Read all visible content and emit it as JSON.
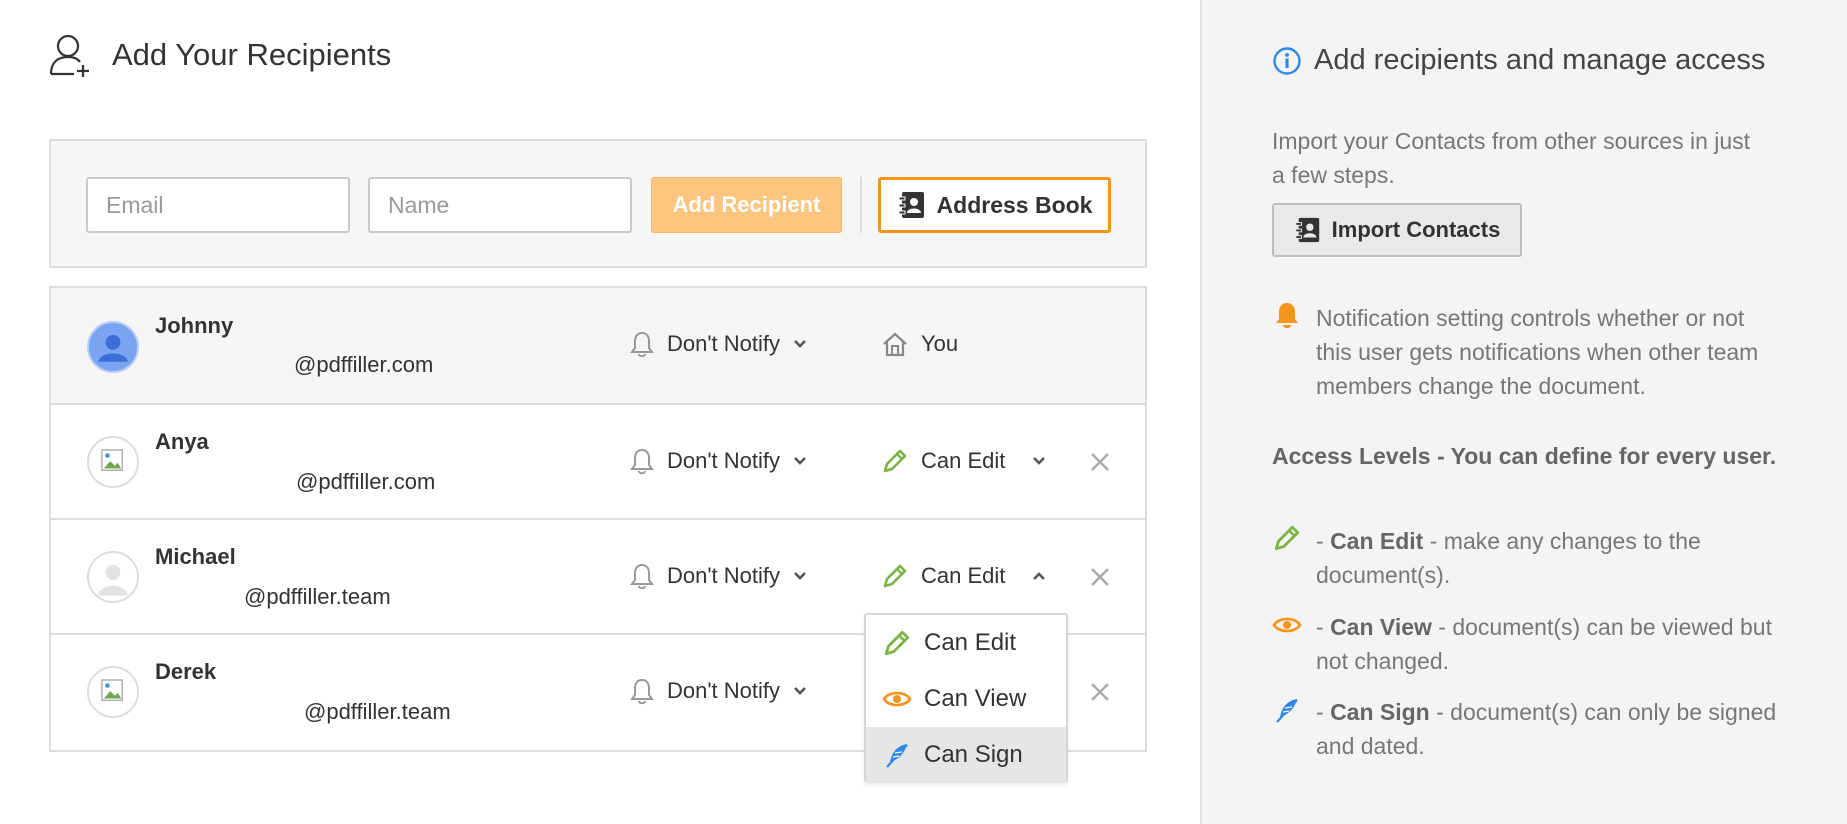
{
  "header": {
    "title": "Add Your Recipients"
  },
  "add_form": {
    "email_placeholder": "Email",
    "name_placeholder": "Name",
    "add_button": "Add Recipient",
    "address_book_button": "Address Book"
  },
  "recipients": [
    {
      "name": "Johnny",
      "email": "@pdffiller.com",
      "notify": "Don't Notify",
      "access": "You",
      "avatar": "user-avatar-blue"
    },
    {
      "name": "Anya",
      "email": "@pdffiller.com",
      "notify": "Don't Notify",
      "access": "Can Edit",
      "avatar": "broken-image-avatar"
    },
    {
      "name": "Michael",
      "email": "@pdffiller.team",
      "notify": "Don't Notify",
      "access": "Can Edit",
      "avatar": "default-user-avatar"
    },
    {
      "name": "Derek",
      "email": "@pdffiller.team",
      "notify": "Don't Notify",
      "access": "",
      "avatar": "broken-image-avatar"
    }
  ],
  "access_dropdown": {
    "options": [
      "Can Edit",
      "Can View",
      "Can Sign"
    ],
    "selected": "Can Sign"
  },
  "help": {
    "title": "Add recipients and manage access",
    "import_text": "Import your Contacts from other sources in just a few steps.",
    "import_button": "Import Contacts",
    "notification_text": "Notification setting controls whether or not this user gets notifications when other team members change the document.",
    "access_heading": "Access Levels - You can define for every user.",
    "levels": [
      {
        "prefix": "- ",
        "name": "Can Edit",
        "desc": " - make any changes to the document(s)."
      },
      {
        "prefix": "- ",
        "name": "Can View",
        "desc": " - document(s) can be viewed but not changed."
      },
      {
        "prefix": "- ",
        "name": "Can Sign",
        "desc": " - document(s) can only be signed and dated."
      }
    ]
  },
  "colors": {
    "accent_orange": "#f7941d",
    "add_button_bg": "#fcc681",
    "edit_green": "#7cb342",
    "view_orange": "#f7941d",
    "sign_blue": "#2e8ae6",
    "info_blue": "#2e8ae6"
  },
  "icons": [
    "add-user-icon",
    "address-book-icon",
    "bell-icon",
    "chevron-down-icon",
    "chevron-up-icon",
    "home-icon",
    "pencil-icon",
    "eye-icon",
    "feather-icon",
    "close-icon",
    "info-icon"
  ]
}
